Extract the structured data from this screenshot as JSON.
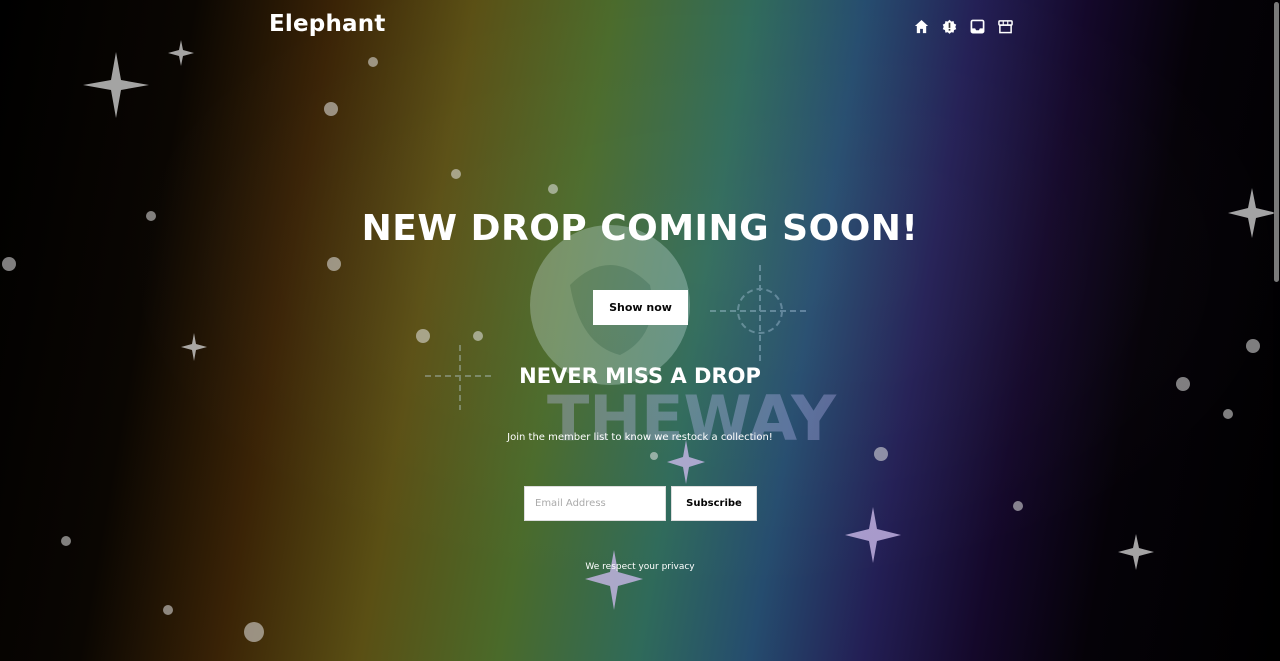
{
  "header": {
    "brand": "Elephant",
    "nav_icons": [
      "home-icon",
      "alert-icon",
      "inbox-icon",
      "store-icon"
    ]
  },
  "hero": {
    "headline": "NEW DROP COMING SOON!",
    "cta_label": "Show now",
    "background_logo_text": "THEWAY"
  },
  "newsletter": {
    "title": "NEVER MISS A DROP",
    "description": "Join the member list to know we restock a collection!",
    "email_placeholder": "Email Address",
    "email_value": "",
    "subscribe_label": "Subscribe",
    "privacy_text": "We respect your privacy"
  },
  "colors": {
    "text": "#ffffff",
    "button_bg": "#ffffff",
    "button_text": "#000000"
  }
}
